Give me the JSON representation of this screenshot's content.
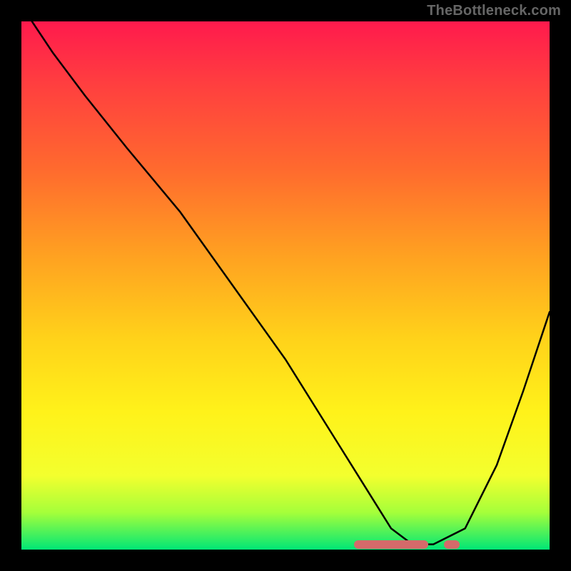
{
  "watermark": "TheBottleneck.com",
  "chart_data": {
    "type": "line",
    "title": "",
    "xlabel": "",
    "ylabel": "",
    "xlim": [
      0,
      100
    ],
    "ylim": [
      0,
      100
    ],
    "grid": false,
    "legend": false,
    "series": [
      {
        "name": "curve",
        "x": [
          2,
          6,
          12,
          20,
          30,
          40,
          50,
          60,
          65,
          70,
          74,
          78,
          84,
          90,
          95,
          100
        ],
        "y": [
          100,
          94,
          86,
          76,
          64,
          50,
          36,
          20,
          12,
          4,
          1,
          1,
          4,
          16,
          30,
          45
        ]
      }
    ],
    "annotations": [
      {
        "name": "dip-highlight-1",
        "x_start": 63,
        "x_end": 77,
        "y": 1
      },
      {
        "name": "dip-highlight-2",
        "x_start": 80,
        "x_end": 83,
        "y": 1
      }
    ],
    "background_gradient": {
      "direction": "top-to-bottom",
      "stops": [
        {
          "pos": 0.0,
          "color": "#ff1a4d"
        },
        {
          "pos": 0.12,
          "color": "#ff3f3f"
        },
        {
          "pos": 0.28,
          "color": "#ff6a2e"
        },
        {
          "pos": 0.44,
          "color": "#ffa021"
        },
        {
          "pos": 0.6,
          "color": "#ffd21a"
        },
        {
          "pos": 0.74,
          "color": "#fff21a"
        },
        {
          "pos": 0.86,
          "color": "#f3ff2e"
        },
        {
          "pos": 0.93,
          "color": "#a5ff3a"
        },
        {
          "pos": 1.0,
          "color": "#00e676"
        }
      ]
    }
  }
}
